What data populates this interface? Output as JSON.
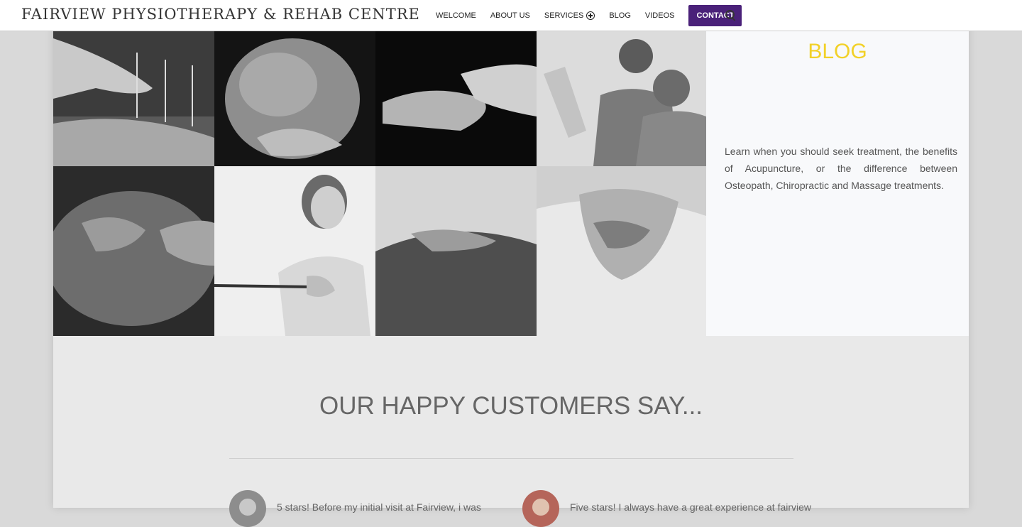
{
  "header": {
    "logo": "FAIRVIEW PHYSIOTHERAPY & REHAB CENTRE",
    "nav": [
      "WELCOME",
      "ABOUT US",
      "SERVICES",
      "BLOG",
      "VIDEOS"
    ],
    "contact": "CONTACT"
  },
  "blog": {
    "title": "BLOG",
    "text": "Learn when you should seek treatment, the benefits of Acupuncture, or the difference between Osteopath, Chiropractic and Massage treatments."
  },
  "testimonials": {
    "title": "OUR HAPPY CUSTOMERS SAY...",
    "items": [
      {
        "text": "5 stars! Before my initial visit at Fairview, i was"
      },
      {
        "text": "Five stars! I always have a great experience at fairview"
      }
    ]
  },
  "colors": {
    "accent": "#4a2179",
    "blog_title": "#f2d128"
  },
  "icons": [
    "plus-circle-icon",
    "search-icon"
  ]
}
